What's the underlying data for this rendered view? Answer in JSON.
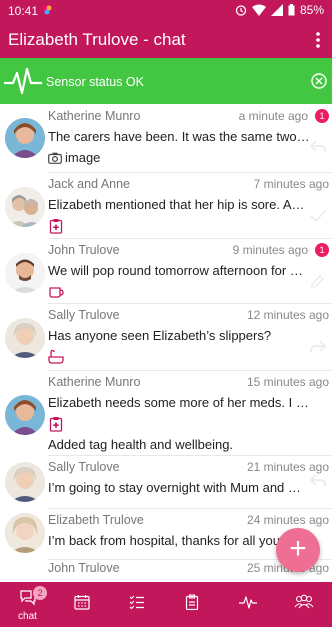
{
  "status_bar": {
    "time": "10:41",
    "battery": "85%",
    "icons": [
      "notification-icon",
      "alarm-icon",
      "wifi-icon",
      "signal-icon",
      "battery-icon"
    ]
  },
  "app_bar": {
    "title": "Elizabeth Trulove - chat",
    "menu_icon": "more-vert-icon"
  },
  "sensor_banner": {
    "text": "Sensor status OK",
    "icon": "pulse-icon",
    "close_icon": "close-circle-icon",
    "color": "#43c743"
  },
  "messages": [
    {
      "name": "Katherine Munro",
      "time": "a minute ago",
      "badge": "1",
      "text": "The carers have been. It was the same two as...",
      "attachment": "image"
    },
    {
      "name": "Jack and Anne",
      "time": "7 minutes ago",
      "text": "Elizabeth mentioned that her hip is sore. And I..."
    },
    {
      "name": "John Trulove",
      "time": "9 minutes ago",
      "badge": "1",
      "text": "We will pop round tomorrow afternoon for a c..."
    },
    {
      "name": "Sally Trulove",
      "time": "12 minutes ago",
      "text": "Has anyone seen Elizabeth’s slippers?"
    },
    {
      "name": "Katherine Munro",
      "time": "15 minutes ago",
      "text": "Elizabeth needs some more of her meds. I hav...",
      "extra": "Added tag health and wellbeing."
    },
    {
      "name": "Sally Trulove",
      "time": "21 minutes ago",
      "text": "I’m going to stay overnight with Mum and mak..."
    },
    {
      "name": "Elizabeth Trulove",
      "time": "24 minutes ago",
      "text": "I’m back from hospital, thanks for all your"
    },
    {
      "name": "John Trulove",
      "time": "25 minutes ago"
    }
  ],
  "fab": {
    "label": "+"
  },
  "bottom_nav": {
    "chat_label": "chat",
    "chat_count": "2",
    "items": [
      "chat-icon",
      "calendar-icon",
      "tasks-icon",
      "clipboard-icon",
      "activity-icon",
      "people-icon"
    ]
  },
  "colors": {
    "primary": "#c2185b",
    "accent": "#e91e63",
    "fab": "#ee6f93",
    "tag": "#c2185b"
  }
}
